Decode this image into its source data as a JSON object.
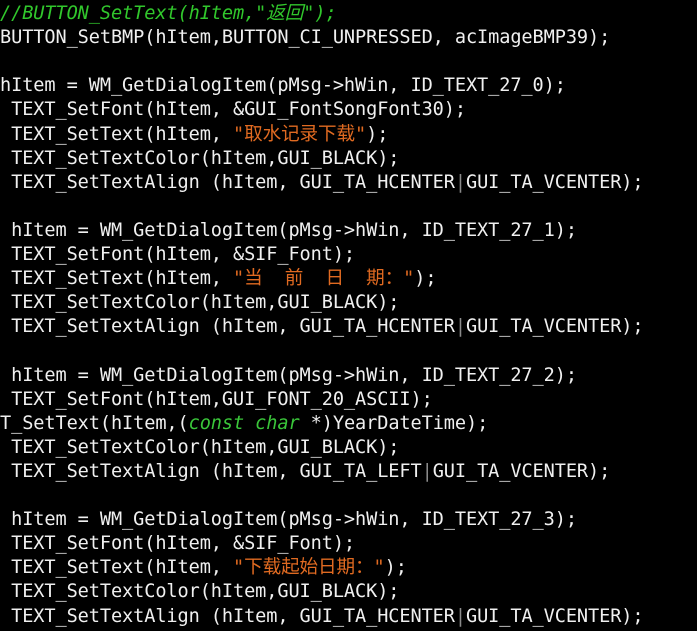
{
  "colors": {
    "background": "#000000",
    "text": "#f0f0f0",
    "comment": "#31c72c",
    "string": "#e06a21",
    "keyword": "#3ac63a"
  },
  "lines": [
    {
      "segments": [
        {
          "t": "//BUTTON_SetText(hItem,\"返回\");",
          "k": "comment"
        }
      ]
    },
    {
      "segments": [
        {
          "t": "BUTTON_SetBMP(hItem,BUTTON_CI_UNPRESSED, acImageBMP39);",
          "k": "text"
        }
      ]
    },
    {
      "segments": []
    },
    {
      "segments": [
        {
          "t": "hItem = WM_GetDialogItem(pMsg->hWin, ID_TEXT_27_0);",
          "k": "text"
        }
      ]
    },
    {
      "segments": [
        {
          "t": " TEXT_SetFont(hItem, &GUI_FontSongFont30);",
          "k": "text"
        }
      ]
    },
    {
      "segments": [
        {
          "t": " TEXT_SetText(hItem, ",
          "k": "text"
        },
        {
          "t": "\"取水记录下载\"",
          "k": "string"
        },
        {
          "t": ");",
          "k": "text"
        }
      ]
    },
    {
      "segments": [
        {
          "t": " TEXT_SetTextColor(hItem,GUI_BLACK);",
          "k": "text"
        }
      ]
    },
    {
      "segments": [
        {
          "t": " TEXT_SetTextAlign (hItem, GUI_TA_HCENTER",
          "k": "text"
        },
        {
          "t": "|",
          "k": "bar"
        },
        {
          "t": "GUI_TA_VCENTER);",
          "k": "text"
        }
      ]
    },
    {
      "segments": []
    },
    {
      "segments": [
        {
          "t": " hItem = WM_GetDialogItem(pMsg->hWin, ID_TEXT_27_1);",
          "k": "text"
        }
      ]
    },
    {
      "segments": [
        {
          "t": " TEXT_SetFont(hItem, &SIF_Font);",
          "k": "text"
        }
      ]
    },
    {
      "segments": [
        {
          "t": " TEXT_SetText(hItem, ",
          "k": "text"
        },
        {
          "t": "\"当  前  日  期：\"",
          "k": "string"
        },
        {
          "t": ");",
          "k": "text"
        }
      ]
    },
    {
      "segments": [
        {
          "t": " TEXT_SetTextColor(hItem,GUI_BLACK);",
          "k": "text"
        }
      ]
    },
    {
      "segments": [
        {
          "t": " TEXT_SetTextAlign (hItem, GUI_TA_HCENTER",
          "k": "text"
        },
        {
          "t": "|",
          "k": "bar"
        },
        {
          "t": "GUI_TA_VCENTER);",
          "k": "text"
        }
      ]
    },
    {
      "segments": []
    },
    {
      "segments": [
        {
          "t": " hItem = WM_GetDialogItem(pMsg->hWin, ID_TEXT_27_2);",
          "k": "text"
        }
      ]
    },
    {
      "segments": [
        {
          "t": " TEXT_SetFont(hItem,GUI_FONT_20_ASCII);",
          "k": "text"
        }
      ]
    },
    {
      "segments": [
        {
          "t": "T_SetText(hItem,(",
          "k": "text"
        },
        {
          "t": "const char ",
          "k": "keyword"
        },
        {
          "t": "*)YearDateTime);",
          "k": "text"
        }
      ]
    },
    {
      "segments": [
        {
          "t": " TEXT_SetTextColor(hItem,GUI_BLACK);",
          "k": "text"
        }
      ]
    },
    {
      "segments": [
        {
          "t": " TEXT_SetTextAlign (hItem, GUI_TA_LEFT",
          "k": "text"
        },
        {
          "t": "|",
          "k": "bar"
        },
        {
          "t": "GUI_TA_VCENTER);",
          "k": "text"
        }
      ]
    },
    {
      "segments": []
    },
    {
      "segments": [
        {
          "t": " hItem = WM_GetDialogItem(pMsg->hWin, ID_TEXT_27_3);",
          "k": "text"
        }
      ]
    },
    {
      "segments": [
        {
          "t": " TEXT_SetFont(hItem, &SIF_Font);",
          "k": "text"
        }
      ]
    },
    {
      "segments": [
        {
          "t": " TEXT_SetText(hItem, ",
          "k": "text"
        },
        {
          "t": "\"下载起始日期：\"",
          "k": "string"
        },
        {
          "t": ");",
          "k": "text"
        }
      ]
    },
    {
      "segments": [
        {
          "t": " TEXT_SetTextColor(hItem,GUI_BLACK);",
          "k": "text"
        }
      ]
    },
    {
      "segments": [
        {
          "t": " TEXT_SetTextAlign (hItem, GUI_TA_HCENTER",
          "k": "text"
        },
        {
          "t": "|",
          "k": "bar"
        },
        {
          "t": "GUI_TA_VCENTER);",
          "k": "text"
        }
      ]
    }
  ]
}
